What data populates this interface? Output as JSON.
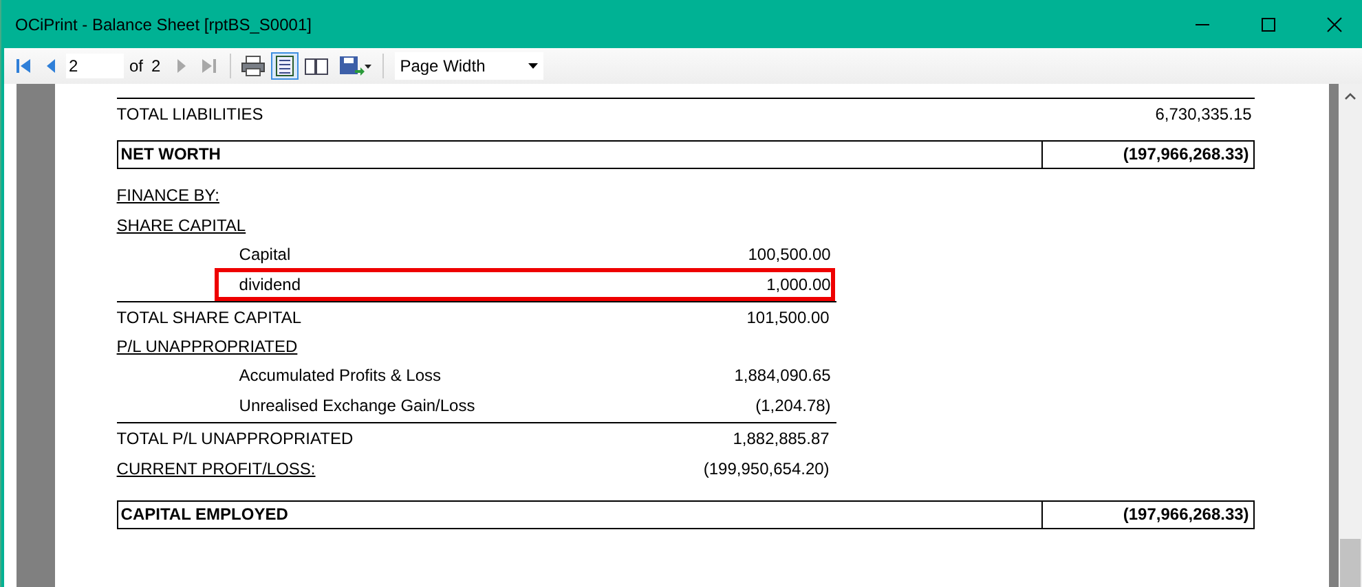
{
  "window": {
    "title": "OCiPrint - Balance Sheet [rptBS_S0001]"
  },
  "toolbar": {
    "nav_buttons": [
      {
        "kind": "first",
        "disabled": false
      },
      {
        "kind": "previous",
        "disabled": false
      }
    ],
    "page_input": {
      "value": "2"
    },
    "of_label": "of",
    "page_count": "2",
    "nav_buttons_after": [
      {
        "kind": "next",
        "disabled": true
      },
      {
        "kind": "last",
        "disabled": true
      }
    ],
    "tool_buttons": [
      {
        "kind": "print",
        "selected": false
      },
      {
        "kind": "layout",
        "selected": true
      },
      {
        "kind": "setup",
        "selected": false
      },
      {
        "kind": "export",
        "selected": false
      }
    ],
    "zoom_select": {
      "value": "Page Width"
    }
  },
  "report": {
    "rows": [
      {
        "kind": "total",
        "label": "TOTAL LIABILITIES",
        "value": "6,730,335.15",
        "rule_above": true
      },
      {
        "kind": "boxed",
        "label": "NET WORTH",
        "value": "(197,966,268.33)"
      },
      {
        "kind": "heading",
        "label": "FINANCE BY:"
      },
      {
        "kind": "heading",
        "label": "SHARE CAPITAL"
      },
      {
        "kind": "item",
        "label": "Capital",
        "value": "100,500.00",
        "highlighted": false
      },
      {
        "kind": "item",
        "label": "dividend",
        "value": "1,000.00",
        "highlighted": true
      },
      {
        "kind": "subtotal",
        "label": "TOTAL SHARE CAPITAL",
        "value": "101,500.00",
        "rule_above": true
      },
      {
        "kind": "heading",
        "label": "P/L UNAPPROPRIATED"
      },
      {
        "kind": "item",
        "label": "Accumulated Profits & Loss",
        "value": "1,884,090.65",
        "highlighted": false
      },
      {
        "kind": "item",
        "label": "Unrealised Exchange Gain/Loss",
        "value": "(1,204.78)",
        "highlighted": false
      },
      {
        "kind": "subtotal",
        "label": "TOTAL P/L UNAPPROPRIATED",
        "value": "1,882,885.87",
        "rule_above": true
      },
      {
        "kind": "heading_value",
        "label": "CURRENT PROFIT/LOSS:",
        "value": "(199,950,654.20)"
      },
      {
        "kind": "boxed",
        "label": "CAPITAL EMPLOYED",
        "value": "(197,966,268.33)"
      }
    ]
  }
}
